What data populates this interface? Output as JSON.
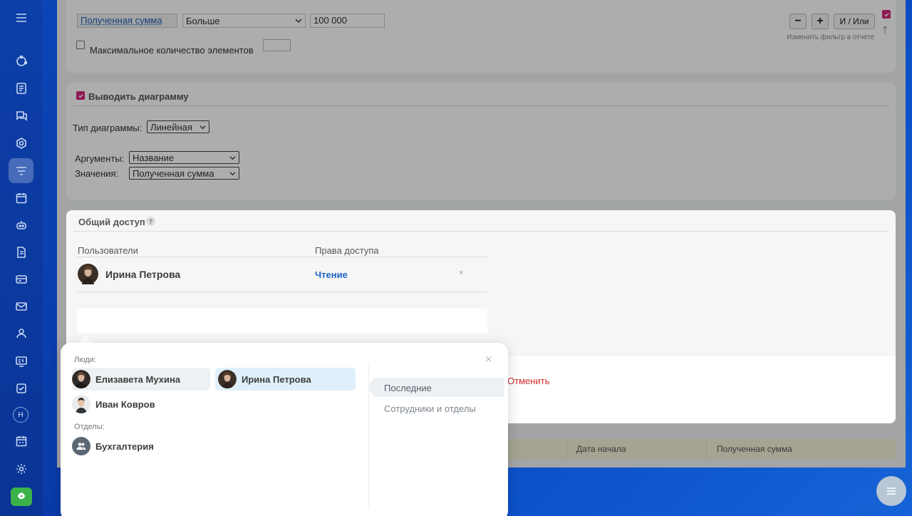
{
  "sidebar": {
    "icons": [
      "menu-icon",
      "feed-icon",
      "tasks-list-icon",
      "chat-icon",
      "hexagon-icon",
      "filter-icon",
      "calendar-icon",
      "robot-icon",
      "document-icon",
      "card-icon",
      "mail-icon",
      "contacts-icon",
      "presentation-icon",
      "checkbox-icon",
      "avatar",
      "schedule-icon",
      "settings-icon",
      "rocket-icon"
    ],
    "avatar_letter": "Н"
  },
  "filter": {
    "field_label": "Полученная сумма",
    "operator": "Больше",
    "value": "100 000",
    "minus": "−",
    "plus": "+",
    "and_or": "И / Или",
    "change_in_report_hint": "Изменять фильтр в отчете",
    "max_items_label": "Максимальное количество элементов"
  },
  "chart": {
    "enable_label": "Выводить диаграмму",
    "type_label": "Тип диаграммы:",
    "type_value": "Линейная",
    "args_label": "Аргументы:",
    "args_value": "Название",
    "values_label": "Значения:",
    "values_value": "Полученная сумма"
  },
  "access": {
    "title": "Общий доступ",
    "help": "?",
    "col_users": "Пользователи",
    "col_rights": "Права доступа",
    "user_name": "Ирина Петрова",
    "user_right": "Чтение",
    "remove": "×",
    "cancel": "Отменить"
  },
  "table": {
    "headers": [
      "Дата начала",
      "Полученная сумма"
    ]
  },
  "popup": {
    "people_label": "Люди:",
    "people": [
      "Елизавета Мухина",
      "Ирина Петрова",
      "Иван Ковров"
    ],
    "departments_label": "Отделы:",
    "departments": [
      "Бухгалтерия"
    ],
    "tabs": [
      "Последние",
      "Сотрудники и отделы"
    ],
    "close": "×"
  },
  "colors": {
    "accent_pink": "#d4297a",
    "link_blue": "#1f63c6",
    "cancel_red": "#d12b2b",
    "rocket_green": "#3cb24a"
  }
}
